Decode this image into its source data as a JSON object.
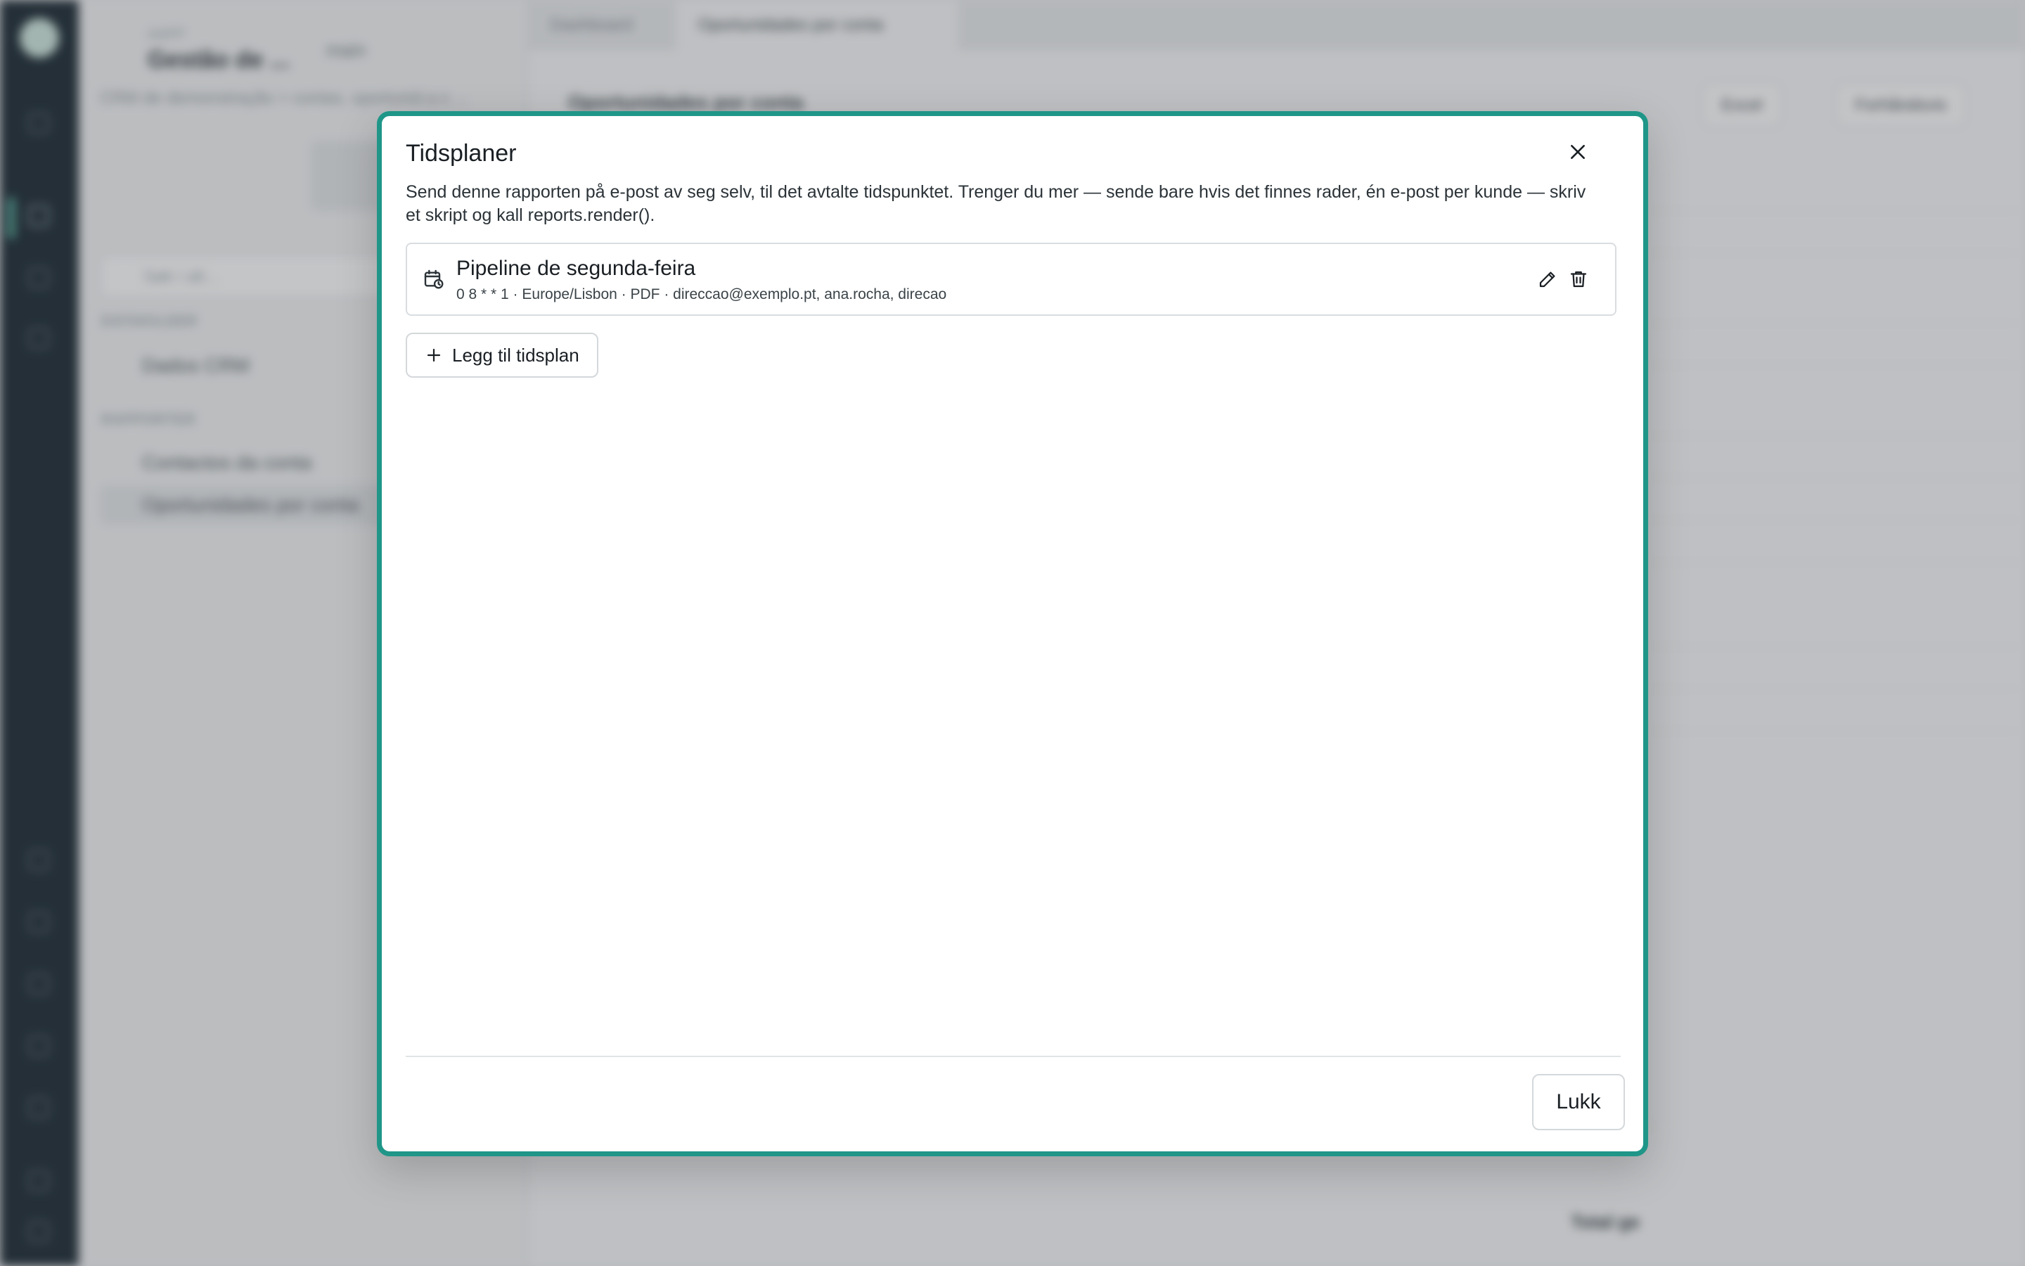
{
  "background": {
    "workspace_small": "AAPP",
    "workspace_title": "Gestão de ...",
    "branch": "main",
    "breadcrumb": "CRM de demonstração > contas, oportunid.a.s ...",
    "search_placeholder": "Søk i alt...",
    "section_datasources": "DATAKILDER",
    "datasource_item": "Dados CRM",
    "section_reports": "RAPPORTER",
    "report_items": [
      "Contactos da conta",
      "Oportunidades por conta"
    ],
    "tabs": [
      "Dashboard",
      "Oportunidades por conta"
    ],
    "main_title": "Oportunidades por conta",
    "btn_excel": "Excel",
    "btn_preview": "Forhåndsvis",
    "table_total": "Total ge"
  },
  "modal": {
    "title": "Tidsplaner",
    "description": "Send denne rapporten på e-post av seg selv, til det avtalte tidspunktet. Trenger du mer — sende bare hvis det finnes rader, én e-post per kunde — skriv et skript og kall reports.render().",
    "schedules": [
      {
        "name": "Pipeline de segunda-feira",
        "meta": "0 8 * * 1 · Europe/Lisbon · PDF · direccao@exemplo.pt, ana.rocha, direcao"
      }
    ],
    "add_label": "Legg til tidsplan",
    "close_label": "Lukk"
  },
  "colors": {
    "accent": "#1f9688",
    "rail": "#14232c"
  },
  "icons": {
    "close": "close-icon",
    "schedule": "calendar-clock-icon",
    "edit": "pencil-icon",
    "delete": "trash-icon",
    "add": "plus-icon"
  }
}
